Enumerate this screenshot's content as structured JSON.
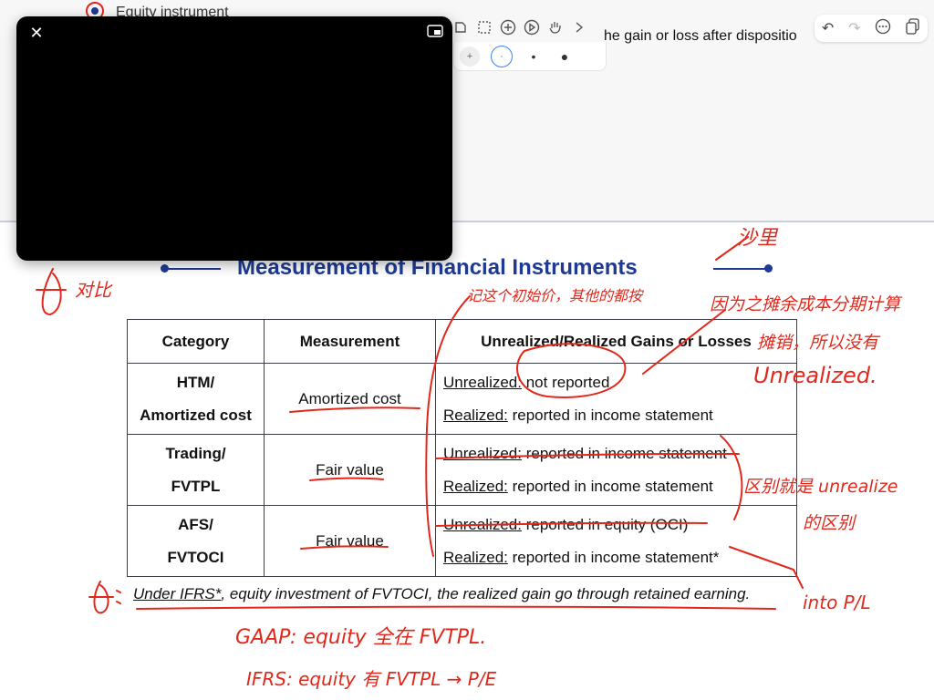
{
  "background_doc": {
    "peek_text": "Equity instrument",
    "sentence_fragment": "he gain or loss after dispositio"
  },
  "toolbar": {
    "icons": [
      "lasso-icon",
      "select-box-icon",
      "add-icon",
      "play-icon",
      "hand-icon",
      "chevron-right-icon"
    ],
    "pen_sizes": [
      "+",
      "·",
      "•",
      "●"
    ]
  },
  "right_toolbar": {
    "icons": [
      "undo-icon",
      "redo-icon",
      "more-icon",
      "pages-icon"
    ]
  },
  "video_overlay": {
    "close_label": "✕"
  },
  "slide": {
    "title": "Measurement of Financial Instruments",
    "table": {
      "headers": [
        "Category",
        "Measurement",
        "Unrealized/Realized Gains or Losses"
      ],
      "rows": [
        {
          "category_line1": "HTM/",
          "category_line2": "Amortized cost",
          "measurement": "Amortized cost",
          "unrealized_label": "Unrealized:",
          "unrealized_text": " not reported",
          "realized_label": "Realized:",
          "realized_text": " reported in income statement"
        },
        {
          "category_line1": "Trading/",
          "category_line2": "FVTPL",
          "measurement": "Fair value",
          "unrealized_label": "Unrealized:",
          "unrealized_text": " reported in income statement",
          "realized_label": "Realized:",
          "realized_text": " reported in income statement"
        },
        {
          "category_line1": "AFS/",
          "category_line2": "FVTOCI",
          "measurement": "Fair value",
          "unrealized_label": "Unrealized:",
          "unrealized_text": " reported in equity (OCI)",
          "realized_label": "Realized:",
          "realized_text": " reported in income statement*"
        }
      ]
    },
    "footnote_prefix": "Under IFRS*",
    "footnote_rest": ", equity investment of FVTOCI, the realized gain go through retained earning."
  },
  "handwriting": {
    "note_top": "沙里",
    "note_compare": "对比",
    "note_amortized": "记这个初始价，其他的都按",
    "note_reason_1": "因为之摊余成本分期计算",
    "note_reason_2": "摊销，所以没有",
    "note_reason_3": "Unrealized.",
    "note_diff_1": "区别就是 unrealize",
    "note_diff_2": "的区别",
    "note_into": "into P/L",
    "note_gaap": "GAAP: equity 全在 FVTPL.",
    "note_ifrs": "IFRS: equity 有 FVTPL → P/E",
    "ink_color": "#e0281c"
  }
}
